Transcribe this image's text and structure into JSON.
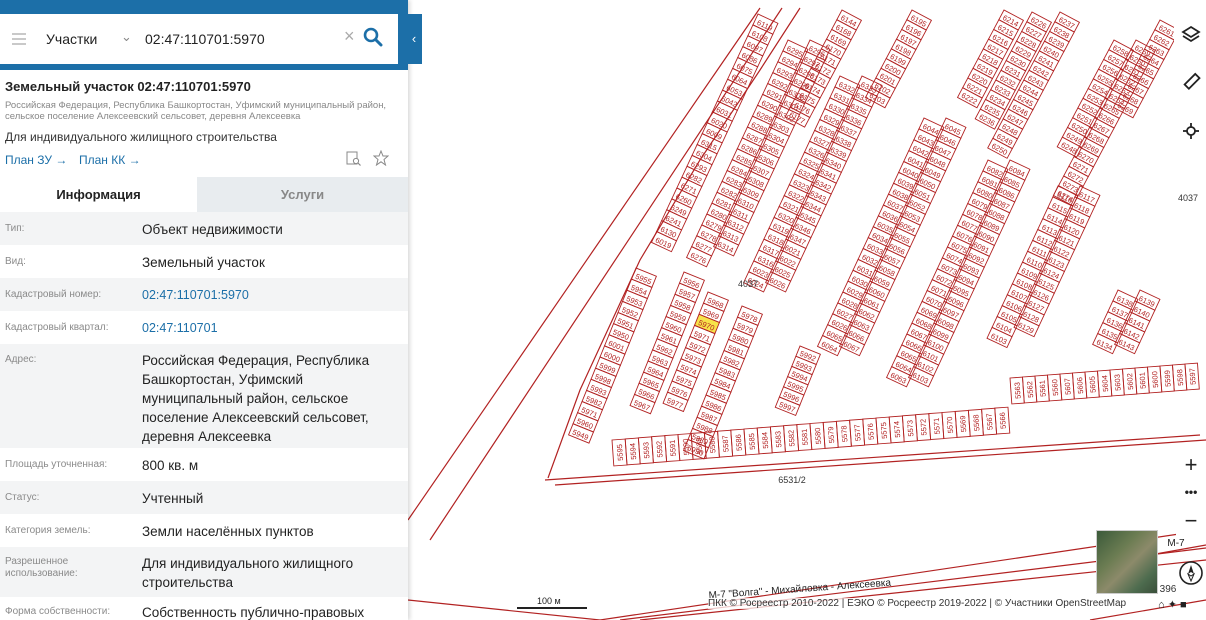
{
  "search": {
    "layer": "Участки",
    "value": "02:47:110701:5970"
  },
  "object": {
    "title": "Земельный участок 02:47:110701:5970",
    "address_small": "Российская Федерация, Республика Башкортостан, Уфимский муниципальный район, сельское поселение Алексеевский сельсовет, деревня Алексеевка",
    "purpose": "Для индивидуального жилищного строительства",
    "plan_zu": "План ЗУ →",
    "plan_kk": "План КК →"
  },
  "tabs": {
    "info": "Информация",
    "services": "Услуги"
  },
  "fields": [
    {
      "label": "Тип:",
      "value": "Объект недвижимости",
      "link": false
    },
    {
      "label": "Вид:",
      "value": "Земельный участок",
      "link": false
    },
    {
      "label": "Кадастровый номер:",
      "value": "02:47:110701:5970",
      "link": true
    },
    {
      "label": "Кадастровый квартал:",
      "value": "02:47:110701",
      "link": true
    },
    {
      "label": "Адрес:",
      "value": "Российская Федерация, Республика Башкортостан, Уфимский муниципальный район, сельское поселение Алексеевский сельсовет, деревня Алексеевка",
      "link": false
    },
    {
      "label": "Площадь уточненная:",
      "value": "800 кв. м",
      "link": false
    },
    {
      "label": "Статус:",
      "value": "Учтенный",
      "link": false
    },
    {
      "label": "Категория земель:",
      "value": "Земли населённых пунктов",
      "link": false
    },
    {
      "label": "Разрешенное использование:",
      "value": "Для индивидуального жилищного строительства",
      "link": false
    },
    {
      "label": "Форма собственности:",
      "value": "Собственность публично-правовых",
      "link": false
    }
  ],
  "map": {
    "labels": {
      "quarter_a": "4037",
      "quarter_b": "4037",
      "parcel_big": "6531/2",
      "road": "М-7 \"Волга\" - Михайловка - Алексеевка",
      "road_right": "М-7",
      "corner": "396",
      "selected": "5970"
    },
    "block_a": [
      "5955",
      "5954",
      "5953",
      "5952",
      "5951",
      "5950",
      "6001",
      "6000",
      "5999",
      "5998",
      "5993",
      "5982",
      "5971",
      "5960",
      "5949"
    ],
    "block_b": [
      "5956",
      "5957",
      "5958",
      "5959",
      "5960",
      "5961",
      "5962",
      "5963",
      "5964",
      "5965",
      "5966",
      "5967"
    ],
    "block_c": [
      "5968",
      "5969",
      "5970",
      "5971",
      "5972",
      "5973",
      "5974",
      "5975",
      "5976",
      "5977"
    ],
    "block_d": [
      "5978",
      "5979",
      "5980",
      "5981",
      "5982",
      "5983",
      "5984",
      "5985",
      "5986",
      "5987",
      "5988",
      "5989",
      "5990"
    ],
    "block_e": [
      "5992",
      "5993",
      "5994",
      "5995",
      "5996",
      "5997"
    ],
    "row_bottom": [
      "5595",
      "5594",
      "5593",
      "5592",
      "5591",
      "5590",
      "5589",
      "5588",
      "5587",
      "5586",
      "5585",
      "5584",
      "5583",
      "5582",
      "5581",
      "5580",
      "5579",
      "5578",
      "5577",
      "5576",
      "5575",
      "5574",
      "5573",
      "5572",
      "5571",
      "5570",
      "5569",
      "5568",
      "5567",
      "5566"
    ],
    "row_right": [
      "5563",
      "5562",
      "5561",
      "5560",
      "5607",
      "5606",
      "5605",
      "5604",
      "5603",
      "5602",
      "5601",
      "5600",
      "5599",
      "5598",
      "5597"
    ],
    "col1": [
      "6119",
      "6108",
      "6097",
      "6086",
      "6075",
      "6064",
      "6053",
      "6042",
      "6031",
      "6020",
      "6009",
      "6315",
      "6304",
      "6293",
      "6282",
      "6271",
      "6260",
      "6249",
      "6241",
      "6130",
      "6019"
    ],
    "col2": [
      "6295",
      "6294",
      "6293",
      "6292",
      "6291",
      "6290",
      "6289",
      "6288",
      "6287",
      "6286",
      "6285",
      "6284",
      "6283",
      "6282",
      "6281",
      "6280",
      "6279",
      "6278",
      "6277",
      "6276"
    ],
    "col3": [
      "6296",
      "6297",
      "6298",
      "6299",
      "6300",
      "6301",
      "6302",
      "6303",
      "6304",
      "6305",
      "6306",
      "6307",
      "6308",
      "6309",
      "6310",
      "6311",
      "6312",
      "6313",
      "6314"
    ],
    "col4": [
      "6332",
      "6331",
      "6330",
      "6329",
      "6328",
      "6327",
      "6326",
      "6325",
      "6324",
      "6323",
      "6322",
      "6321",
      "6320",
      "6319",
      "6318",
      "6317",
      "6316",
      "6023",
      "6024"
    ],
    "col5": [
      "6333",
      "6334",
      "6335",
      "6336",
      "6337",
      "6338",
      "6339",
      "6340",
      "6341",
      "6342",
      "6343",
      "6344",
      "6345",
      "6346",
      "6347",
      "6021",
      "6022",
      "6025",
      "6026"
    ],
    "col6": [
      "6044",
      "6043",
      "6042",
      "6041",
      "6040",
      "6039",
      "6038",
      "6037",
      "6036",
      "6035",
      "6034",
      "6033",
      "6032",
      "6031",
      "6030",
      "6029",
      "6028",
      "6027",
      "6026",
      "6065",
      "6064"
    ],
    "col7": [
      "6045",
      "6046",
      "6047",
      "6048",
      "6049",
      "6050",
      "6051",
      "6052",
      "6053",
      "6054",
      "6055",
      "6056",
      "6057",
      "6058",
      "6059",
      "6060",
      "6061",
      "6062",
      "6063",
      "6066",
      "6067"
    ],
    "col8": [
      "6082",
      "6081",
      "6080",
      "6079",
      "6078",
      "6077",
      "6076",
      "6075",
      "6074",
      "6073",
      "6072",
      "6071",
      "6070",
      "6069",
      "6068",
      "6067",
      "6066",
      "6065",
      "6064",
      "6063"
    ],
    "col9": [
      "6084",
      "6085",
      "6086",
      "6087",
      "6088",
      "6089",
      "6090",
      "6091",
      "6092",
      "6093",
      "6094",
      "6095",
      "6096",
      "6097",
      "6098",
      "6099",
      "6100",
      "6101",
      "6102",
      "6103"
    ],
    "col10": [
      "6116",
      "6115",
      "6114",
      "6113",
      "6112",
      "6111",
      "6110",
      "6109",
      "6108",
      "6107",
      "6106",
      "6105",
      "6104",
      "6103"
    ],
    "col11": [
      "6117",
      "6118",
      "6119",
      "6120",
      "6121",
      "6122",
      "6123",
      "6124",
      "6125",
      "6126",
      "6127",
      "6128",
      "6129"
    ],
    "col12": [
      "6138",
      "6137",
      "6136",
      "6135",
      "6134"
    ],
    "col13": [
      "6139",
      "6140",
      "6141",
      "6142",
      "6143"
    ],
    "top_a": [
      "6144",
      "6168",
      "6169",
      "6170",
      "6171",
      "6172",
      "6173",
      "6174",
      "6175",
      "6176",
      "6177"
    ],
    "top_b": [
      "6195",
      "6196",
      "6197",
      "6198",
      "6199",
      "6200",
      "6201",
      "6202",
      "6203"
    ],
    "top_c": [
      "6214",
      "6215",
      "6216",
      "6217",
      "6218",
      "6219",
      "6220",
      "6221",
      "6222"
    ],
    "top_d": [
      "6226",
      "6227",
      "6228",
      "6229",
      "6230",
      "6231",
      "6232",
      "6233",
      "6234",
      "6235",
      "6236"
    ],
    "top_e": [
      "6237",
      "6238",
      "6239",
      "6240",
      "6241",
      "6242",
      "6243",
      "6244",
      "6245",
      "6246",
      "6247",
      "6248",
      "6249",
      "6250"
    ],
    "top_f": [
      "6258",
      "6257",
      "6256",
      "6255",
      "6254",
      "6253",
      "6252",
      "6251",
      "6250",
      "6249",
      "6248"
    ],
    "top_g": [
      "6259",
      "6260",
      "6261",
      "6262",
      "6263",
      "6264",
      "6265",
      "6266",
      "6267",
      "6268",
      "6269",
      "6270",
      "6271",
      "6272",
      "6273",
      "6274"
    ],
    "top_h": [
      "6261",
      "6262",
      "6263",
      "6264",
      "6265",
      "6266",
      "6267",
      "6268",
      "6269"
    ]
  },
  "scale": "100 м",
  "attribution": "ПКК © Росреестр 2010-2022 | ЕЭКО © Росреестр 2019-2022 | © Участники OpenStreetMap",
  "colors": {
    "brand": "#1c6fa8",
    "parcel": "#b22222",
    "selected": "#f7e34a"
  }
}
